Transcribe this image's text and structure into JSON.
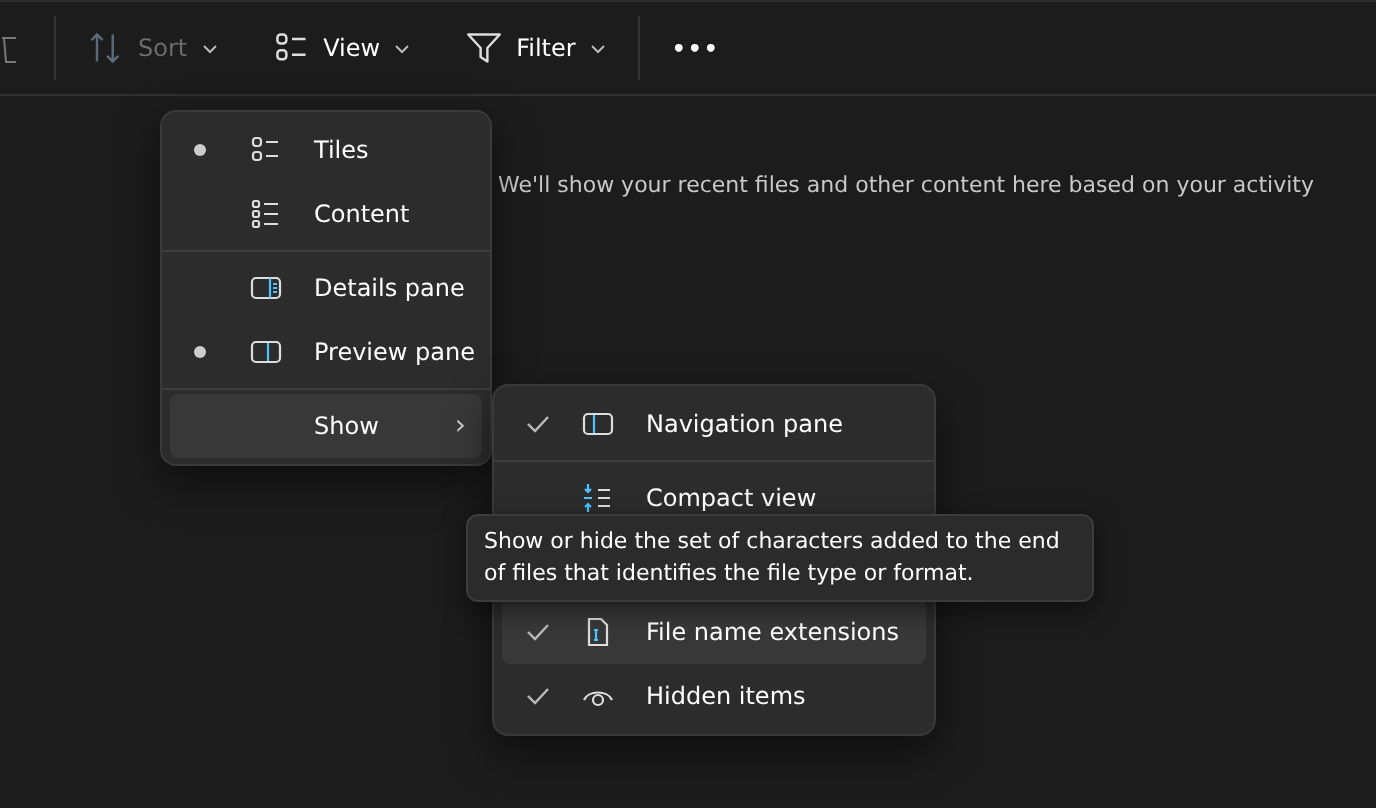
{
  "toolbar": {
    "buttons": [
      {
        "kind": "sort",
        "label": "Sort",
        "disabled": true
      },
      {
        "kind": "view",
        "label": "View",
        "disabled": false
      },
      {
        "kind": "filter",
        "label": "Filter",
        "disabled": false
      }
    ],
    "more": "•••"
  },
  "empty_message": "We'll show your recent files and other content here based on your activity",
  "view_menu": {
    "items": [
      {
        "kind": "tiles",
        "label": "Tiles",
        "selected": true
      },
      {
        "kind": "content",
        "label": "Content",
        "selected": false
      },
      {
        "kind": "details",
        "label": "Details pane",
        "selected": false
      },
      {
        "kind": "preview",
        "label": "Preview pane",
        "selected": true
      },
      {
        "kind": "show",
        "label": "Show",
        "selected": false,
        "arrow": "›"
      }
    ]
  },
  "show_menu": {
    "items": [
      {
        "kind": "navigation",
        "label": "Navigation pane",
        "checked": true,
        "hovered": false
      },
      {
        "kind": "compact",
        "label": "Compact view",
        "checked": false,
        "hovered": false
      },
      {
        "kind": "extensions",
        "label": "File name extensions",
        "checked": true,
        "hovered": true
      },
      {
        "kind": "hidden",
        "label": "Hidden items",
        "checked": true,
        "hovered": false
      }
    ]
  },
  "tooltip": "Show or hide the set of characters added to the end of files that identifies the file type or format."
}
